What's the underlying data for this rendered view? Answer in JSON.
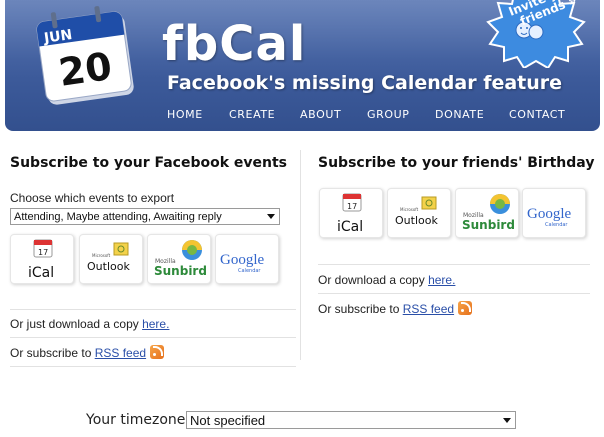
{
  "header": {
    "calendar_month": "JUN",
    "calendar_day": "20",
    "brand": "fbCal",
    "tagline": "Facebook's missing Calendar feature",
    "badge": "Invite your friends »",
    "nav": [
      "Home",
      "Create",
      "About",
      "Group",
      "Donate",
      "Contact"
    ]
  },
  "left": {
    "title": "Subscribe to your Facebook events",
    "choose_label": "Choose which events to export",
    "events_select": "Attending, Maybe attending, Awaiting reply",
    "apps": {
      "ical": "iCal",
      "ical_day": "17",
      "outlook_small": "Microsoft",
      "outlook": "Outlook",
      "sunbird_small": "Mozilla",
      "sunbird": "Sunbird",
      "google": "Google",
      "google_small": "Calendar"
    },
    "download_prefix": "Or just download a copy ",
    "download_link": "here.",
    "subscribe_prefix": "Or subscribe to ",
    "rss_link": "RSS feed"
  },
  "right": {
    "title": "Subscribe to your friends' Birthday",
    "download_prefix": "Or download a copy ",
    "download_link": "here.",
    "subscribe_prefix": "Or subscribe to ",
    "rss_link": "RSS feed"
  },
  "timezone": {
    "label": "Your timezone",
    "value": "Not specified"
  },
  "colors": {
    "header_blue": "#3c5a9a",
    "link_blue": "#2a4fa8",
    "rss_orange": "#e5701c",
    "badge_blue": "#3d8be0"
  }
}
